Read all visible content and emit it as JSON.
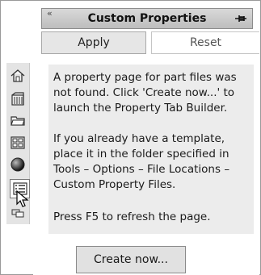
{
  "panel": {
    "title": "Custom Properties",
    "collapse_icon": "collapse-icon",
    "pin_icon": "pin-icon"
  },
  "buttons": {
    "apply": "Apply",
    "reset": "Reset",
    "create": "Create now..."
  },
  "message": {
    "p1": "A property page for part files was not found. Click 'Create now...' to launch the Property Tab Builder.",
    "p2": "If you already have a template, place it in the folder specified in Tools – Options – File Locations – Custom Property Files.",
    "p3": "Press F5 to refresh the page."
  },
  "sidebar": {
    "items": [
      {
        "icon": "home-icon"
      },
      {
        "icon": "library-icon"
      },
      {
        "icon": "folder-icon"
      },
      {
        "icon": "view-palette-icon"
      },
      {
        "icon": "appearance-icon"
      },
      {
        "icon": "custom-properties-icon",
        "active": true
      },
      {
        "icon": "forum-icon"
      }
    ]
  }
}
